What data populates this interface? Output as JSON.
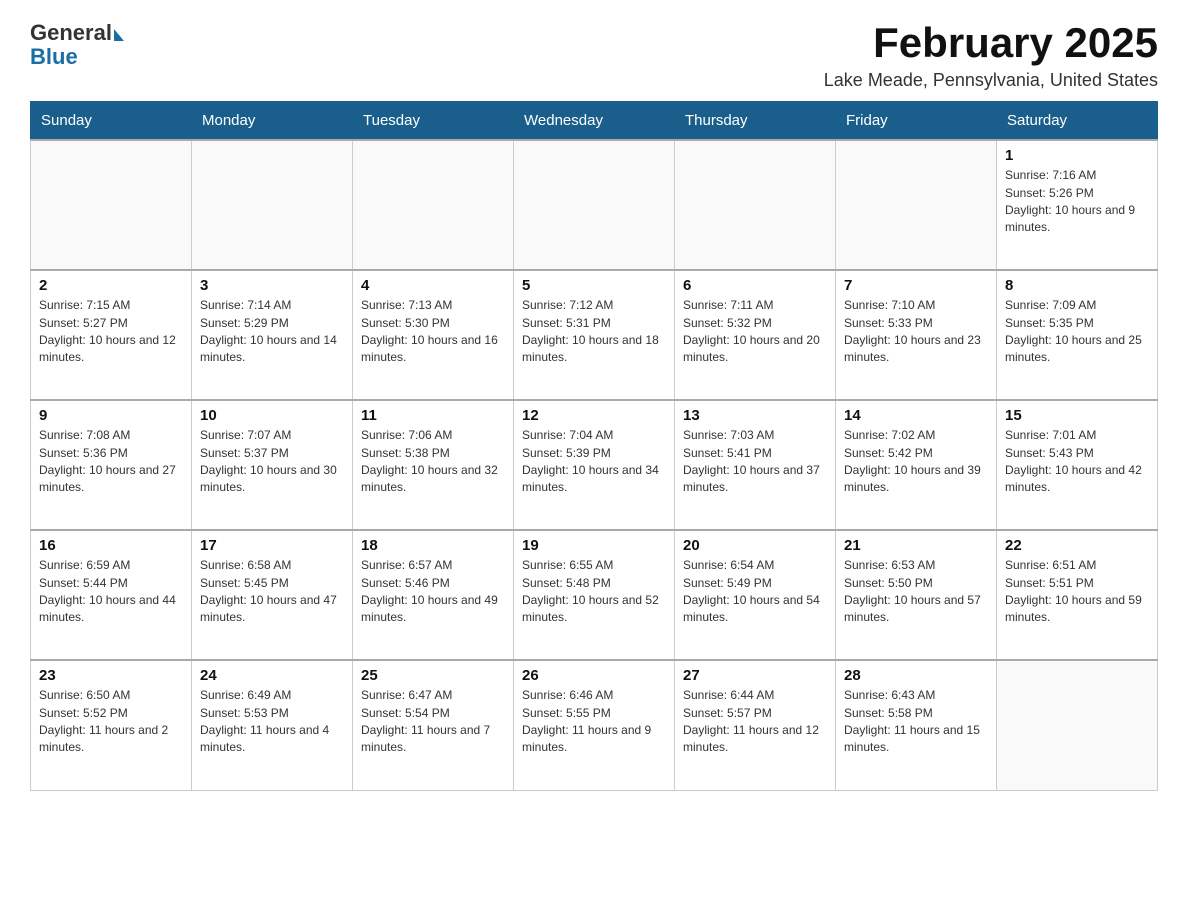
{
  "header": {
    "logo_general": "General",
    "logo_blue": "Blue",
    "month_title": "February 2025",
    "location": "Lake Meade, Pennsylvania, United States"
  },
  "days_of_week": [
    "Sunday",
    "Monday",
    "Tuesday",
    "Wednesday",
    "Thursday",
    "Friday",
    "Saturday"
  ],
  "weeks": [
    [
      {
        "day": "",
        "info": ""
      },
      {
        "day": "",
        "info": ""
      },
      {
        "day": "",
        "info": ""
      },
      {
        "day": "",
        "info": ""
      },
      {
        "day": "",
        "info": ""
      },
      {
        "day": "",
        "info": ""
      },
      {
        "day": "1",
        "info": "Sunrise: 7:16 AM\nSunset: 5:26 PM\nDaylight: 10 hours and 9 minutes."
      }
    ],
    [
      {
        "day": "2",
        "info": "Sunrise: 7:15 AM\nSunset: 5:27 PM\nDaylight: 10 hours and 12 minutes."
      },
      {
        "day": "3",
        "info": "Sunrise: 7:14 AM\nSunset: 5:29 PM\nDaylight: 10 hours and 14 minutes."
      },
      {
        "day": "4",
        "info": "Sunrise: 7:13 AM\nSunset: 5:30 PM\nDaylight: 10 hours and 16 minutes."
      },
      {
        "day": "5",
        "info": "Sunrise: 7:12 AM\nSunset: 5:31 PM\nDaylight: 10 hours and 18 minutes."
      },
      {
        "day": "6",
        "info": "Sunrise: 7:11 AM\nSunset: 5:32 PM\nDaylight: 10 hours and 20 minutes."
      },
      {
        "day": "7",
        "info": "Sunrise: 7:10 AM\nSunset: 5:33 PM\nDaylight: 10 hours and 23 minutes."
      },
      {
        "day": "8",
        "info": "Sunrise: 7:09 AM\nSunset: 5:35 PM\nDaylight: 10 hours and 25 minutes."
      }
    ],
    [
      {
        "day": "9",
        "info": "Sunrise: 7:08 AM\nSunset: 5:36 PM\nDaylight: 10 hours and 27 minutes."
      },
      {
        "day": "10",
        "info": "Sunrise: 7:07 AM\nSunset: 5:37 PM\nDaylight: 10 hours and 30 minutes."
      },
      {
        "day": "11",
        "info": "Sunrise: 7:06 AM\nSunset: 5:38 PM\nDaylight: 10 hours and 32 minutes."
      },
      {
        "day": "12",
        "info": "Sunrise: 7:04 AM\nSunset: 5:39 PM\nDaylight: 10 hours and 34 minutes."
      },
      {
        "day": "13",
        "info": "Sunrise: 7:03 AM\nSunset: 5:41 PM\nDaylight: 10 hours and 37 minutes."
      },
      {
        "day": "14",
        "info": "Sunrise: 7:02 AM\nSunset: 5:42 PM\nDaylight: 10 hours and 39 minutes."
      },
      {
        "day": "15",
        "info": "Sunrise: 7:01 AM\nSunset: 5:43 PM\nDaylight: 10 hours and 42 minutes."
      }
    ],
    [
      {
        "day": "16",
        "info": "Sunrise: 6:59 AM\nSunset: 5:44 PM\nDaylight: 10 hours and 44 minutes."
      },
      {
        "day": "17",
        "info": "Sunrise: 6:58 AM\nSunset: 5:45 PM\nDaylight: 10 hours and 47 minutes."
      },
      {
        "day": "18",
        "info": "Sunrise: 6:57 AM\nSunset: 5:46 PM\nDaylight: 10 hours and 49 minutes."
      },
      {
        "day": "19",
        "info": "Sunrise: 6:55 AM\nSunset: 5:48 PM\nDaylight: 10 hours and 52 minutes."
      },
      {
        "day": "20",
        "info": "Sunrise: 6:54 AM\nSunset: 5:49 PM\nDaylight: 10 hours and 54 minutes."
      },
      {
        "day": "21",
        "info": "Sunrise: 6:53 AM\nSunset: 5:50 PM\nDaylight: 10 hours and 57 minutes."
      },
      {
        "day": "22",
        "info": "Sunrise: 6:51 AM\nSunset: 5:51 PM\nDaylight: 10 hours and 59 minutes."
      }
    ],
    [
      {
        "day": "23",
        "info": "Sunrise: 6:50 AM\nSunset: 5:52 PM\nDaylight: 11 hours and 2 minutes."
      },
      {
        "day": "24",
        "info": "Sunrise: 6:49 AM\nSunset: 5:53 PM\nDaylight: 11 hours and 4 minutes."
      },
      {
        "day": "25",
        "info": "Sunrise: 6:47 AM\nSunset: 5:54 PM\nDaylight: 11 hours and 7 minutes."
      },
      {
        "day": "26",
        "info": "Sunrise: 6:46 AM\nSunset: 5:55 PM\nDaylight: 11 hours and 9 minutes."
      },
      {
        "day": "27",
        "info": "Sunrise: 6:44 AM\nSunset: 5:57 PM\nDaylight: 11 hours and 12 minutes."
      },
      {
        "day": "28",
        "info": "Sunrise: 6:43 AM\nSunset: 5:58 PM\nDaylight: 11 hours and 15 minutes."
      },
      {
        "day": "",
        "info": ""
      }
    ]
  ]
}
